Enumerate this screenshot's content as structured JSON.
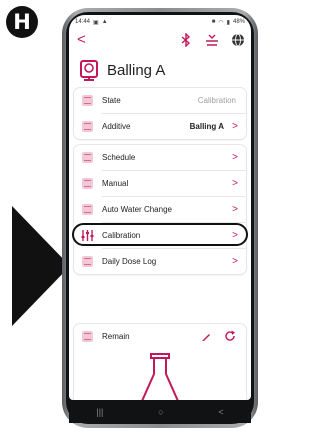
{
  "step_badge": "H",
  "status_bar": {
    "time": "14:44",
    "battery": "48%"
  },
  "app": {
    "title": "Balling A"
  },
  "info_rows": [
    {
      "label": "State",
      "value": "Calibration"
    },
    {
      "label": "Additive",
      "value": "Balling A"
    }
  ],
  "menu_rows": [
    {
      "label": "Schedule"
    },
    {
      "label": "Manual"
    },
    {
      "label": "Auto Water Change"
    },
    {
      "label": "Calibration"
    },
    {
      "label": "Daily Dose Log"
    }
  ],
  "remain": {
    "label": "Remain"
  },
  "colors": {
    "accent": "#c2185b",
    "icon_bg": "#f2c8d6",
    "callout": "#111111"
  },
  "icons": [
    "back-chevron-icon",
    "bluetooth-icon",
    "feed-icon",
    "globe-icon",
    "dosing-head-icon",
    "row-icon",
    "calibration-icon",
    "chevron-right-icon",
    "edit-pencil-icon",
    "refresh-icon",
    "flask-icon",
    "callout-arrow-icon"
  ]
}
